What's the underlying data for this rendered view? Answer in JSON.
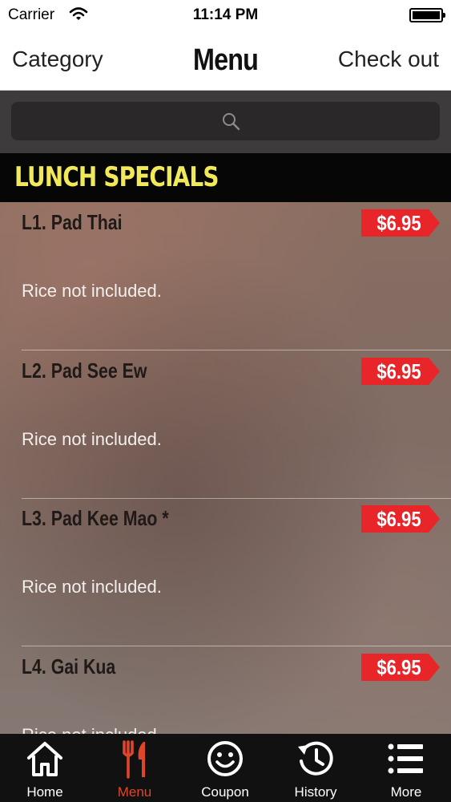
{
  "status_bar": {
    "carrier": "Carrier",
    "time": "11:14 PM"
  },
  "nav": {
    "left_label": "Category",
    "title": "Menu",
    "right_label": "Check out"
  },
  "search": {
    "placeholder": ""
  },
  "section": {
    "title": "LUNCH SPECIALS"
  },
  "items": [
    {
      "name": "L1. Pad Thai",
      "price": "$6.95",
      "description": "Rice not included."
    },
    {
      "name": "L2. Pad See Ew",
      "price": "$6.95",
      "description": "Rice not included."
    },
    {
      "name": "L3. Pad Kee Mao *",
      "price": "$6.95",
      "description": "Rice not included."
    },
    {
      "name": "L4. Gai Kua",
      "price": "$6.95",
      "description": "Rice not included."
    }
  ],
  "tabs": [
    {
      "label": "Home",
      "icon": "home-icon"
    },
    {
      "label": "Menu",
      "icon": "fork-knife-icon",
      "active": true
    },
    {
      "label": "Coupon",
      "icon": "smiley-icon"
    },
    {
      "label": "History",
      "icon": "history-icon"
    },
    {
      "label": "More",
      "icon": "list-icon"
    }
  ],
  "colors": {
    "accent": "#e0452a",
    "price_tag": "#e8262a",
    "section_title": "#f1e85a",
    "tab_bar": "#111111"
  }
}
